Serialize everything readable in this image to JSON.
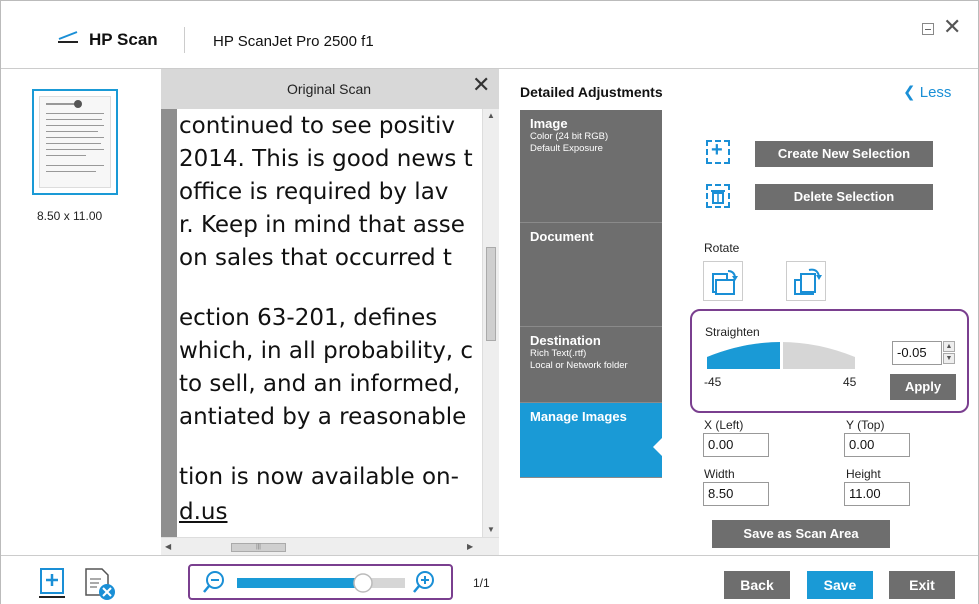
{
  "titlebar": {
    "app_name": "HP Scan",
    "device_name": "HP ScanJet Pro 2500 f1"
  },
  "thumbnails": {
    "size_label": "8.50 x 11.00"
  },
  "scan_pane": {
    "title": "Original Scan",
    "lines": [
      "continued to see positiv",
      "2014. This is good news t",
      "office is required by lav",
      "r. Keep in mind that asse",
      "on sales that occurred t",
      "ection 63-201, defines",
      "which, in all probability, c",
      "to sell, and an informed,",
      "antiated by a reasonable",
      "tion is now available on-",
      "d.us"
    ],
    "hscroll_thumb_glyph": "|||"
  },
  "adjustments": {
    "title": "Detailed Adjustments",
    "less_label": "Less",
    "tabs": [
      {
        "title": "Image",
        "sub": [
          "Color (24 bit RGB)",
          "Default Exposure"
        ]
      },
      {
        "title": "Document",
        "sub": []
      },
      {
        "title": "Destination",
        "sub": [
          "Rich Text(.rtf)",
          "Local or Network folder"
        ]
      },
      {
        "title": "Manage Images",
        "sub": []
      }
    ],
    "create_selection_label": "Create New Selection",
    "delete_selection_label": "Delete Selection",
    "rotate_label": "Rotate",
    "straighten": {
      "label": "Straighten",
      "value": "-0.05",
      "min_label": "-45",
      "max_label": "45",
      "level": 0.4994,
      "apply_label": "Apply"
    },
    "x_label": "X (Left)",
    "x_value": "0.00",
    "y_label": "Y (Top)",
    "y_value": "0.00",
    "width_label": "Width",
    "width_value": "8.50",
    "height_label": "Height",
    "height_value": "11.00",
    "save_scan_area_label": "Save as Scan Area"
  },
  "bottom": {
    "zoom_level": 0.78,
    "page_count": "1/1",
    "back_label": "Back",
    "save_label": "Save",
    "exit_label": "Exit"
  },
  "colors": {
    "accent": "#1a9ad6",
    "tab_grey": "#6e6e6e",
    "highlight_outline": "#7a3f8f"
  }
}
